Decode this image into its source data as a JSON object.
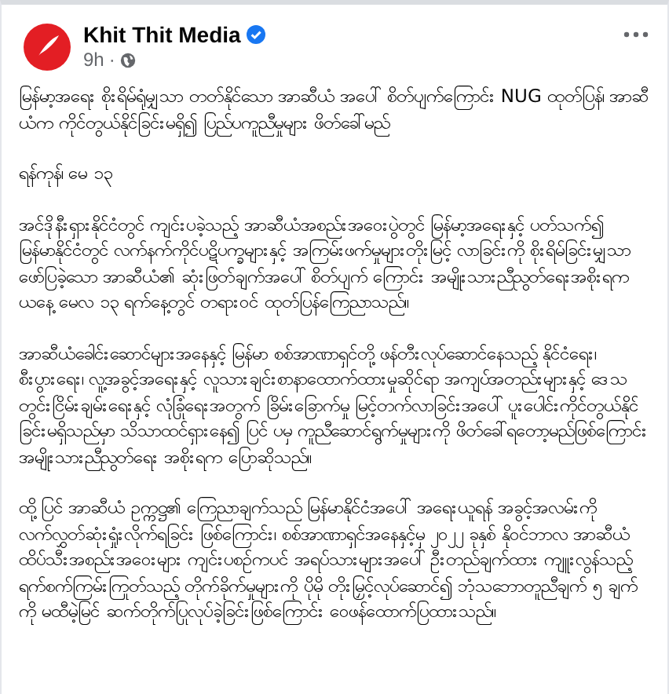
{
  "post": {
    "author": "Khit Thit Media",
    "verified": true,
    "time": "9h",
    "separator": "·",
    "headline": "မြန်မာ့အရေး စိုးရိမ်ရုံမျှသာ တတ်နိုင်သော အာဆီယံ အပေါ် စိတ်ပျက်ကြောင်း NUG ထုတ်ပြန်၊ အာဆီယံက ကိုင်တွယ်နိုင်ခြင်းမရှိ၍ ပြည်ပကူညီမှုများ ဖိတ်ခေါ်မည်",
    "dateline": "ရန်ကုန်၊ မေ ၁၃",
    "paragraphs": [
      "အင်ဒိုနီးရှားနိုင်ငံတွင် ကျင်းပခဲ့သည့် အာဆီယံအစည်းအဝေးပွဲတွင် မြန်မာ့အရေးနှင့် ပတ်သက်၍ မြန်မာနိုင်ငံတွင် လက်နက်ကိုင်ပဋိပက္ခများနှင့် အကြမ်းဖက်မှုများတိုးမြင့် လာခြင်းကို စိုးရိမ်ခြင်းမျှသာ ဖော်ပြခဲ့သော အာဆီယံ၏ ဆုံးဖြတ်ချက်အပေါ် စိတ်ပျက် ကြောင်း အမျိုးသားညီညွတ်ရေးအစိုးရက ယနေ့ မေလ ၁၃ ရက်နေ့တွင် တရားဝင် ထုတ်ပြန်ကြေညာသည်။",
      "အာဆီယံခေါင်းဆောင်များအနေနှင့် မြန်မာ စစ်အာဏာရှင်တို့ ဖန်တီးလုပ်ဆောင်နေသည့် နိုင်ငံရေး၊ စီးပွားရေး၊ လူ့အခွင့်အရေးနှင့် လူသားချင်းစာနာထောက်ထားမှုဆိုင်ရာ အကျပ်အတည်းများနှင့် ဒေသတွင်းငြိမ်းချမ်းရေးနှင့် လုံခြုံရေးအတွက် ခြိမ်းခြောက်မှု မြင့်တက်လာခြင်းအပေါ် ပူးပေါင်းကိုင်တွယ်နိုင်ခြင်းမရှိသည်မှာ သိသာထင်ရှားနေ၍ ပြင် ပမှ ကူညီဆောင်ရွက်မှုများကို ဖိတ်ခေါ်ရတော့မည်ဖြစ်ကြောင်း အမျိုးသားညီညွတ်ရေး အစိုးရက ပြောဆိုသည်။",
      "ထို့ပြင် အာဆီယံ ဥက္ကဋ္ဌ၏ ကြေညာချက်သည် မြန်မာနိုင်ငံအပေါ် အရေးယူရန် အခွင့်အလမ်းကို လက်လွှတ်ဆုံးရှုံးလိုက်ရခြင်း ဖြစ်ကြောင်း၊ စစ်အာဏာရှင်အနေနှင့်မှ ၂၀၂၂ ခုနှစ် နိုဝင်ဘာလ အာဆီယံထိပ်သီးအစည်းအဝေးများ ကျင်းပစဉ်ကပင် အရပ်သားများအပေါ် ဦးတည်ချက်ထား ကျူးလွန်သည့် ရက်စက်ကြမ်းကြုတ်သည့် တိုက်ခိုက်မှုများကို ပိုမို တိုးမြှင့်လုပ်ဆောင်၍ ဘုံသဘောတူညီချက် ၅ ချက်ကို မထီမဲ့မြင် ဆက်တိုက်ပြုလုပ်ခဲ့ခြင်းဖြစ်ကြောင်း  ဝေဖန်ထောက်ပြထားသည်။"
    ]
  }
}
